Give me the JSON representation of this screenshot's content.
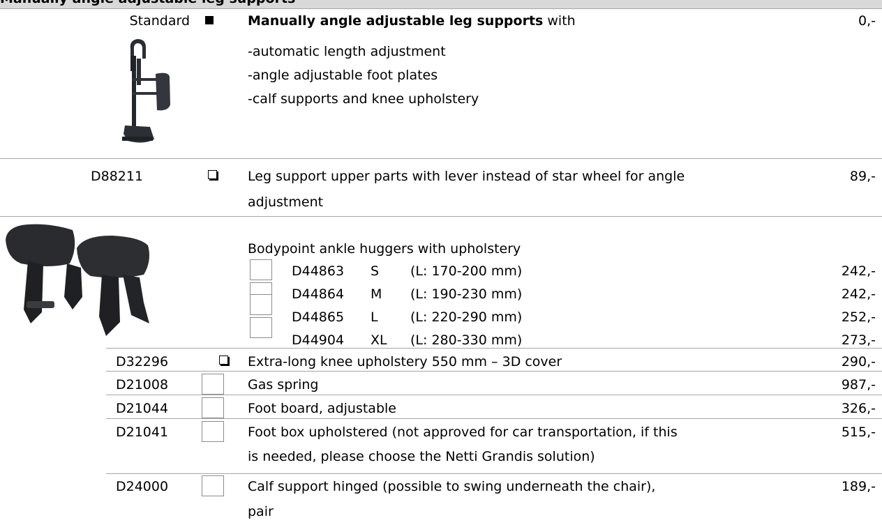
{
  "section_title": "Manually angle adjustable leg supports",
  "rows": {
    "standard": {
      "code": "Standard",
      "title_bold": "Manually angle adjustable leg supports",
      "title_rest": " with",
      "lines": [
        "-automatic length adjustment",
        "-angle adjustable foot plates",
        "-calf supports and knee upholstery"
      ],
      "price": "0,-"
    },
    "d88211": {
      "code": "D88211",
      "line1": "Leg support upper parts with lever instead of star wheel for angle",
      "line2": "adjustment",
      "price": "89,-"
    },
    "huggers": {
      "title": "Bodypoint ankle huggers with upholstery",
      "options": [
        {
          "code": "D44863",
          "size": "S",
          "range": "(L: 170-200 mm)",
          "price": "242,-"
        },
        {
          "code": "D44864",
          "size": "M",
          "range": "(L: 190-230 mm)",
          "price": "242,-"
        },
        {
          "code": "D44865",
          "size": "L",
          "range": "(L: 220-290 mm)",
          "price": "252,-"
        },
        {
          "code": "D44904",
          "size": "XL",
          "range": "(L: 280-330 mm)",
          "price": "273,-"
        }
      ]
    },
    "d32296": {
      "code": "D32296",
      "desc": "Extra-long knee upholstery 550 mm – 3D cover",
      "price": "290,-"
    },
    "d21008": {
      "code": "D21008",
      "desc": "Gas spring",
      "price": "987,-"
    },
    "d21044": {
      "code": "D21044",
      "desc": "Foot board, adjustable",
      "price": "326,-"
    },
    "d21041": {
      "code": "D21041",
      "line1": "Foot box upholstered (not approved for car transportation, if this",
      "line2": "is needed, please choose the Netti Grandis solution)",
      "price": "515,-"
    },
    "d24000": {
      "code": "D24000",
      "line1": "Calf support hinged (possible to swing underneath the chair),",
      "line2": "pair",
      "price": "189,-"
    }
  }
}
